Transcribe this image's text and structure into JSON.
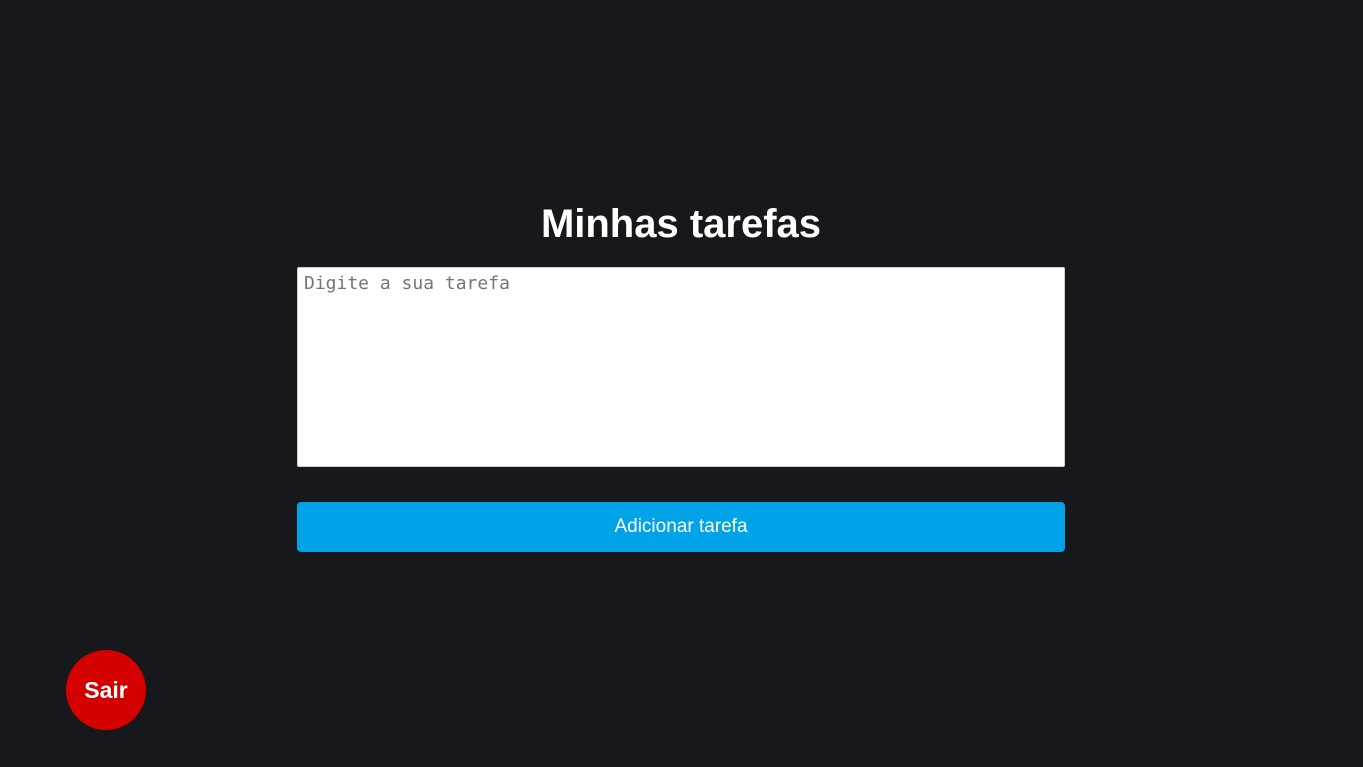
{
  "header": {
    "title": "Minhas tarefas"
  },
  "task_form": {
    "input_value": "",
    "input_placeholder": "Digite a sua tarefa",
    "submit_label": "Adicionar tarefa"
  },
  "logout": {
    "label": "Sair"
  },
  "colors": {
    "background": "#17181c",
    "primary_button": "#00a2e8",
    "logout_button": "#d40000",
    "text": "#ffffff"
  }
}
